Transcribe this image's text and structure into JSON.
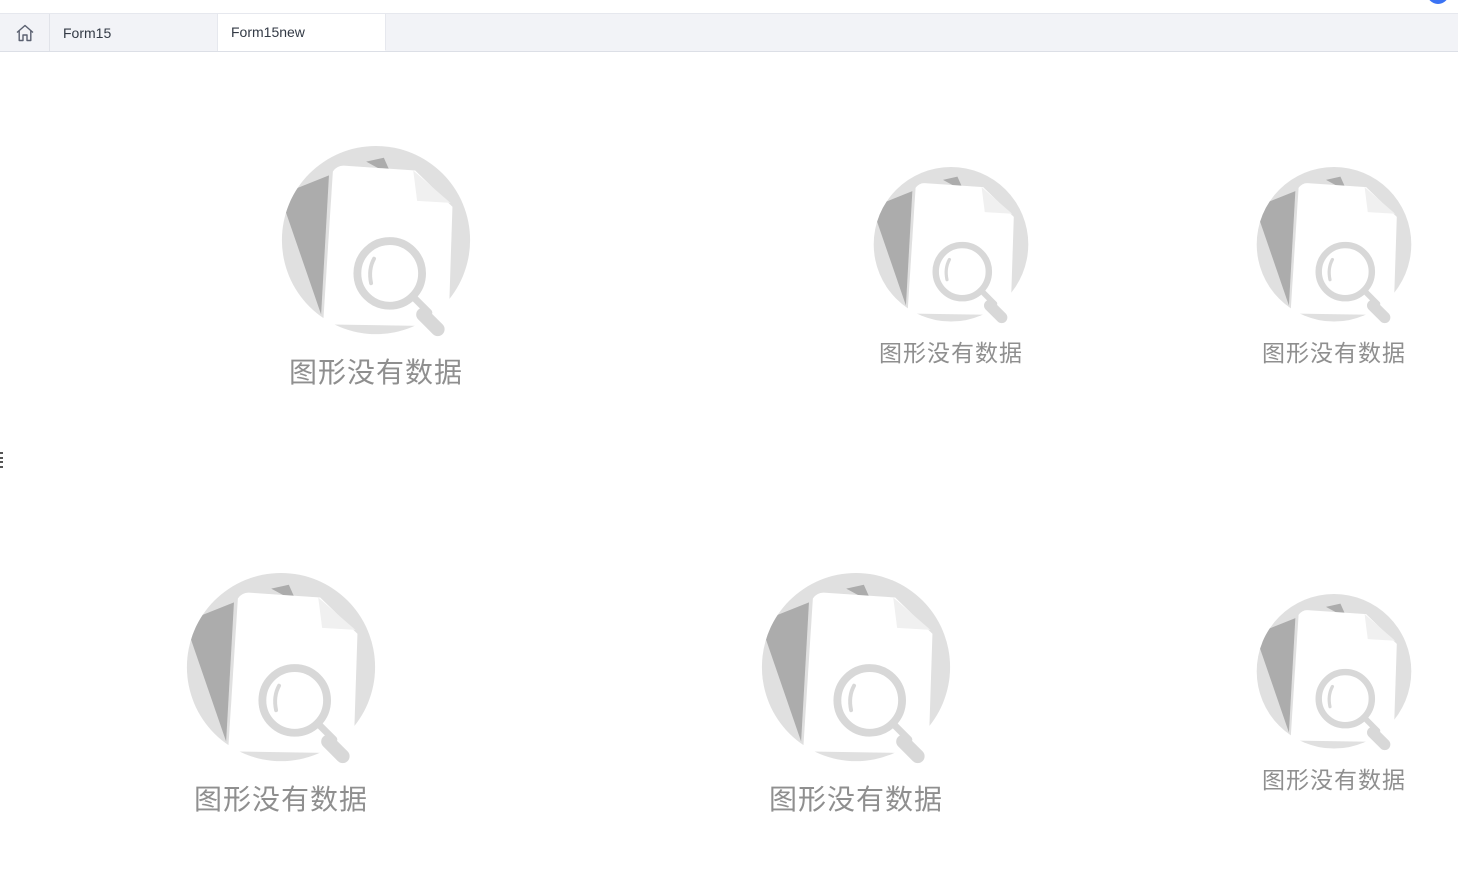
{
  "tabs": {
    "home_icon": "home-icon",
    "items": [
      {
        "label": "Form15",
        "active": false
      },
      {
        "label": "Form15new",
        "active": true
      }
    ]
  },
  "widgets": [
    {
      "message": "图形没有数据",
      "icon": "no-data-illustration"
    },
    {
      "message": "图形没有数据",
      "icon": "no-data-illustration"
    },
    {
      "message": "图形没有数据",
      "icon": "no-data-illustration"
    },
    {
      "message": "图形没有数据",
      "icon": "no-data-illustration"
    },
    {
      "message": "图形没有数据",
      "icon": "no-data-illustration"
    },
    {
      "message": "图形没有数据",
      "icon": "no-data-illustration"
    }
  ],
  "colors": {
    "tabbar_bg": "#f2f3f7",
    "active_tab_bg": "#ffffff",
    "accent": "#3b73f4",
    "illustration_light": "#e0e0e0",
    "illustration_dark": "#acacac",
    "empty_text": "#8f8f8f"
  }
}
